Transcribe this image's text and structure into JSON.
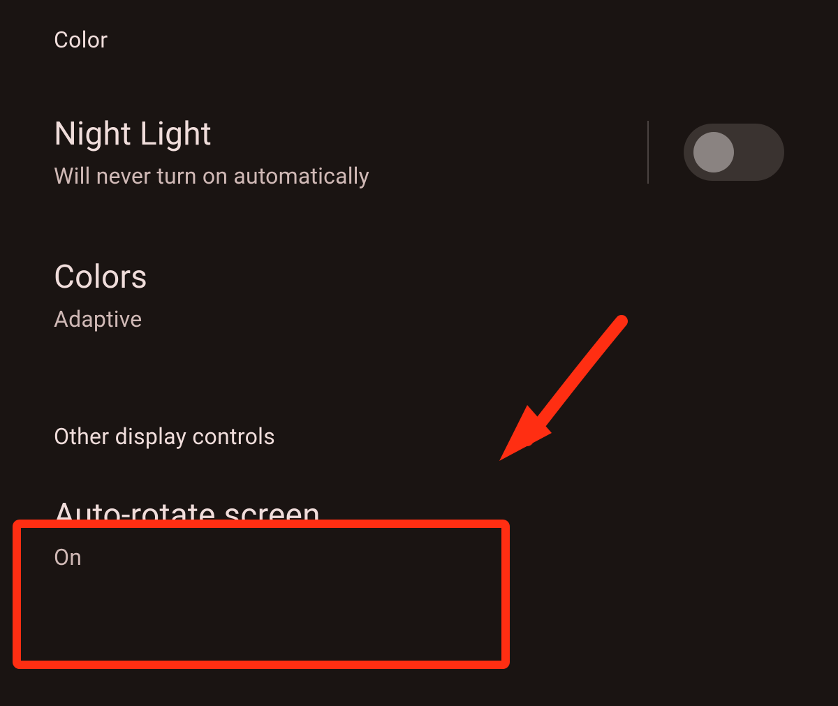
{
  "sections": {
    "color": {
      "header": "Color"
    },
    "other_display": {
      "header": "Other display controls"
    }
  },
  "settings": {
    "night_light": {
      "title": "Night Light",
      "subtitle": "Will never turn on automatically",
      "toggle_state": "off"
    },
    "colors": {
      "title": "Colors",
      "subtitle": "Adaptive"
    },
    "auto_rotate": {
      "title": "Auto-rotate screen",
      "subtitle": "On"
    }
  },
  "annotations": {
    "highlight_color": "#ff2e12"
  }
}
